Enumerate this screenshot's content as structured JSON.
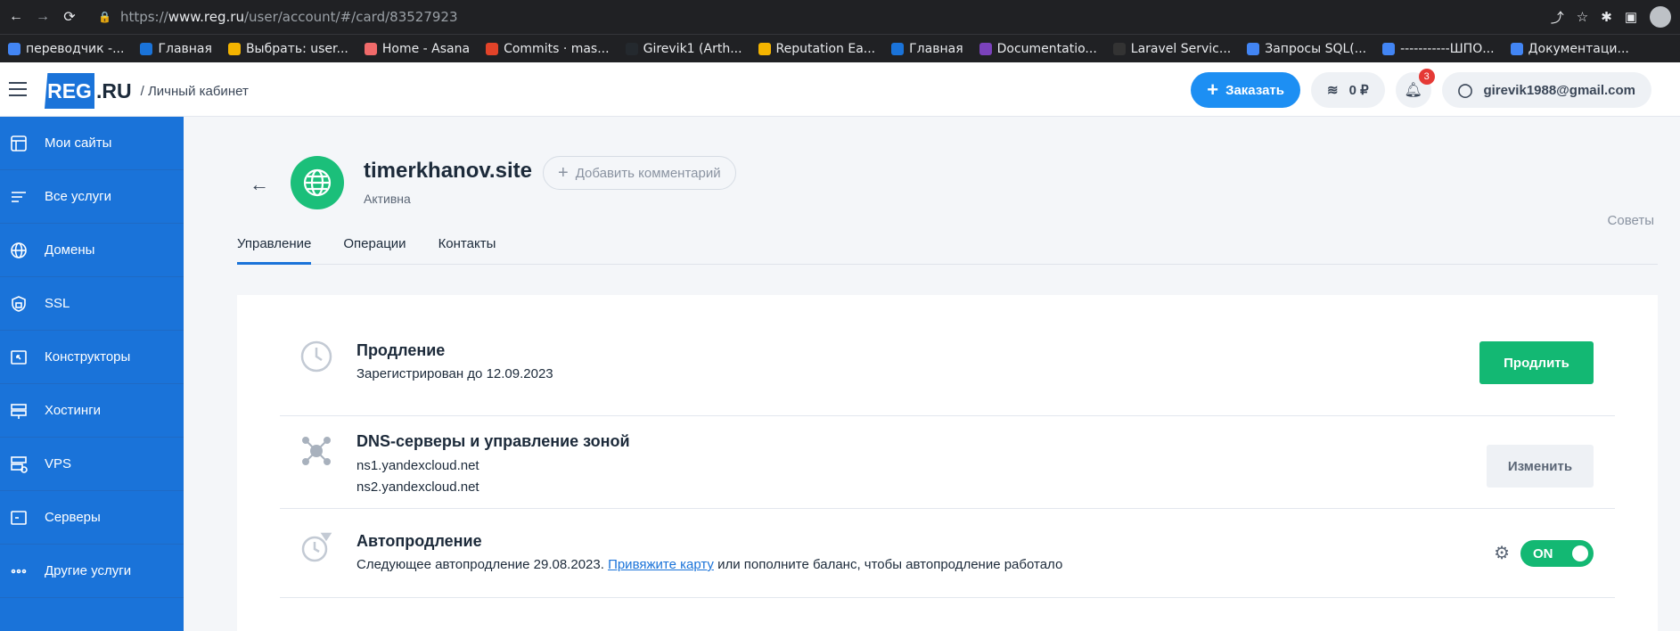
{
  "browser": {
    "url_prefix": "https://",
    "url_host": "www.reg.ru",
    "url_path": "/user/account/#/card/83527923",
    "bookmarks": [
      {
        "label": "переводчик -...",
        "color": "#4285f4"
      },
      {
        "label": "Главная",
        "color": "#1a73d9"
      },
      {
        "label": "Выбрать: user...",
        "color": "#f4b400"
      },
      {
        "label": "Home - Asana",
        "color": "#f06a6a"
      },
      {
        "label": "Commits · mas...",
        "color": "#e24329"
      },
      {
        "label": "Girevik1 (Arth...",
        "color": "#24292e"
      },
      {
        "label": "Reputation Ea...",
        "color": "#f4b400"
      },
      {
        "label": "Главная",
        "color": "#1a73d9"
      },
      {
        "label": "Documentatio...",
        "color": "#7b42bc"
      },
      {
        "label": "Laravel Servic...",
        "color": "#333333"
      },
      {
        "label": "Запросы SQL(...",
        "color": "#4285f4"
      },
      {
        "label": "-----------ШПО...",
        "color": "#4285f4"
      },
      {
        "label": "Документаци...",
        "color": "#4285f4"
      }
    ]
  },
  "header": {
    "logo_text": "REG",
    "logo_suffix": ".RU",
    "breadcrumb": "/ Личный кабинет",
    "order_label": "Заказать",
    "balance": "0 ₽",
    "notifications": "3",
    "user_email": "girevik1988@gmail.com"
  },
  "sidebar": {
    "items": [
      {
        "label": "Мои сайты",
        "icon": "sites-icon"
      },
      {
        "label": "Все услуги",
        "icon": "list-icon"
      },
      {
        "label": "Домены",
        "icon": "globe-icon"
      },
      {
        "label": "SSL",
        "icon": "ssl-shield-icon"
      },
      {
        "label": "Конструкторы",
        "icon": "constructor-icon"
      },
      {
        "label": "Хостинги",
        "icon": "hosting-icon"
      },
      {
        "label": "VPS",
        "icon": "vps-icon"
      },
      {
        "label": "Серверы",
        "icon": "server-icon"
      },
      {
        "label": "Другие услуги",
        "icon": "more-dots-icon"
      }
    ]
  },
  "domain": {
    "name": "timerkhanov.site",
    "status": "Активна",
    "add_comment": "Добавить комментарий",
    "tips": "Советы"
  },
  "tabs": [
    "Управление",
    "Операции",
    "Контакты"
  ],
  "sections": {
    "renewal": {
      "title": "Продление",
      "line": "Зарегистрирован до 12.09.2023",
      "button": "Продлить"
    },
    "dns": {
      "title": "DNS-серверы и управление зоной",
      "ns1": "ns1.yandexcloud.net",
      "ns2": "ns2.yandexcloud.net",
      "button": "Изменить"
    },
    "autorenew": {
      "title": "Автопродление",
      "text_before": "Следующее автопродление 29.08.2023.",
      "link": "Привяжите карту",
      "text_after": "или пополните баланс, чтобы автопродление работало",
      "toggle": "ON"
    }
  },
  "colors": {
    "primary": "#1a73d9",
    "green": "#13b873"
  }
}
